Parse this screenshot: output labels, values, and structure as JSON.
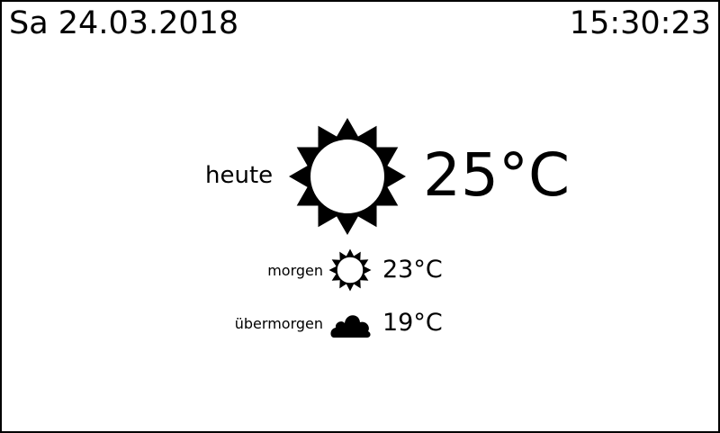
{
  "header": {
    "date": "Sa 24.03.2018",
    "time": "15:30:23"
  },
  "today": {
    "label": "heute",
    "icon": "sun-icon",
    "temperature": "25°C"
  },
  "forecast": [
    {
      "label": "morgen",
      "icon": "sun-icon",
      "temperature": "23°C"
    },
    {
      "label": "übermorgen",
      "icon": "cloud-icon",
      "temperature": "19°C"
    }
  ]
}
